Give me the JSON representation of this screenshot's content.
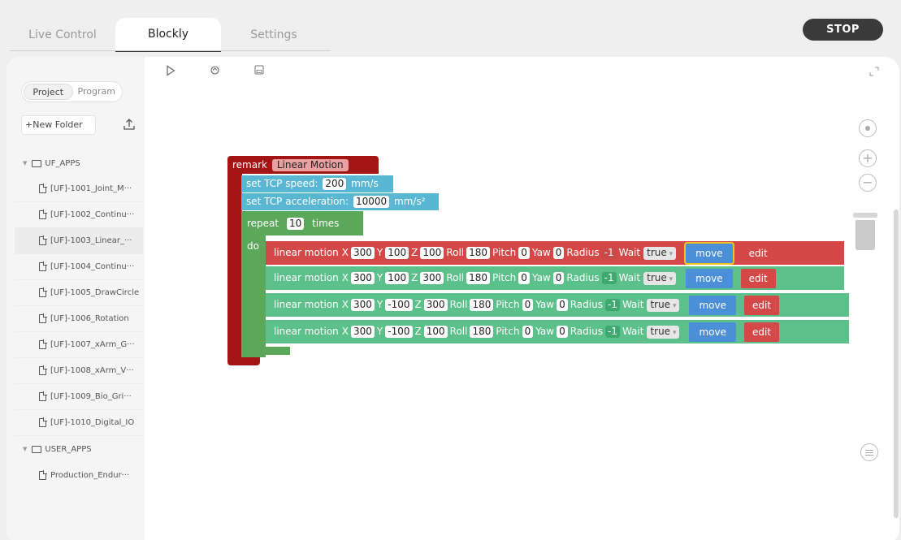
{
  "tabs": [
    "Live Control",
    "Blockly",
    "Settings"
  ],
  "stop_label": "STOP",
  "sidebar": {
    "segments": [
      "Project",
      "Program"
    ],
    "new_folder": "+New Folder",
    "folders": [
      {
        "name": "UF_APPS",
        "items": [
          "[UF]-1001_Joint_M···",
          "[UF]-1002_Continu···",
          "[UF]-1003_Linear_···",
          "[UF]-1004_Continu···",
          "[UF]-1005_DrawCircle",
          "[UF]-1006_Rotation",
          "[UF]-1007_xArm_G···",
          "[UF]-1008_xArm_V···",
          "[UF]-1009_Bio_Gri···",
          "[UF]-1010_Digital_IO"
        ]
      },
      {
        "name": "USER_APPS",
        "items": [
          "Production_Endur···"
        ]
      }
    ]
  },
  "toolbar": {
    "icons": [
      "play-icon",
      "sync-icon",
      "save-icon",
      "expand-icon"
    ]
  },
  "controls": {
    "icons": [
      "target-icon",
      "zoom-in-icon",
      "zoom-out-icon",
      "trash-icon",
      "list-icon"
    ]
  },
  "blocks": {
    "remark_label": "remark",
    "remark_value": "Linear Motion",
    "tcp_speed": {
      "label": "set TCP speed:",
      "value": "200",
      "unit": "mm/s"
    },
    "tcp_accel": {
      "label": "set TCP acceleration:",
      "value": "10000",
      "unit": "mm/s²"
    },
    "repeat": {
      "label": "repeat",
      "value": "10",
      "suffix": "times",
      "do_label": "do"
    },
    "motion_labels": {
      "name": "linear motion",
      "x": "X",
      "y": "Y",
      "z": "Z",
      "roll": "Roll",
      "pitch": "Pitch",
      "yaw": "Yaw",
      "radius": "Radius",
      "wait": "Wait",
      "move": "move",
      "edit": "edit"
    },
    "motions": [
      {
        "x": "300",
        "y": "100",
        "z": "100",
        "roll": "180",
        "pitch": "0",
        "yaw": "0",
        "radius": "-1",
        "wait": "true",
        "color": "#d44848"
      },
      {
        "x": "300",
        "y": "100",
        "z": "300",
        "roll": "180",
        "pitch": "0",
        "yaw": "0",
        "radius": "-1",
        "wait": "true",
        "color": "#5cc08a"
      },
      {
        "x": "300",
        "y": "-100",
        "z": "300",
        "roll": "180",
        "pitch": "0",
        "yaw": "0",
        "radius": "-1",
        "wait": "true",
        "color": "#5cc08a"
      },
      {
        "x": "300",
        "y": "-100",
        "z": "100",
        "roll": "180",
        "pitch": "0",
        "yaw": "0",
        "radius": "-1",
        "wait": "true",
        "color": "#5cc08a"
      }
    ]
  }
}
